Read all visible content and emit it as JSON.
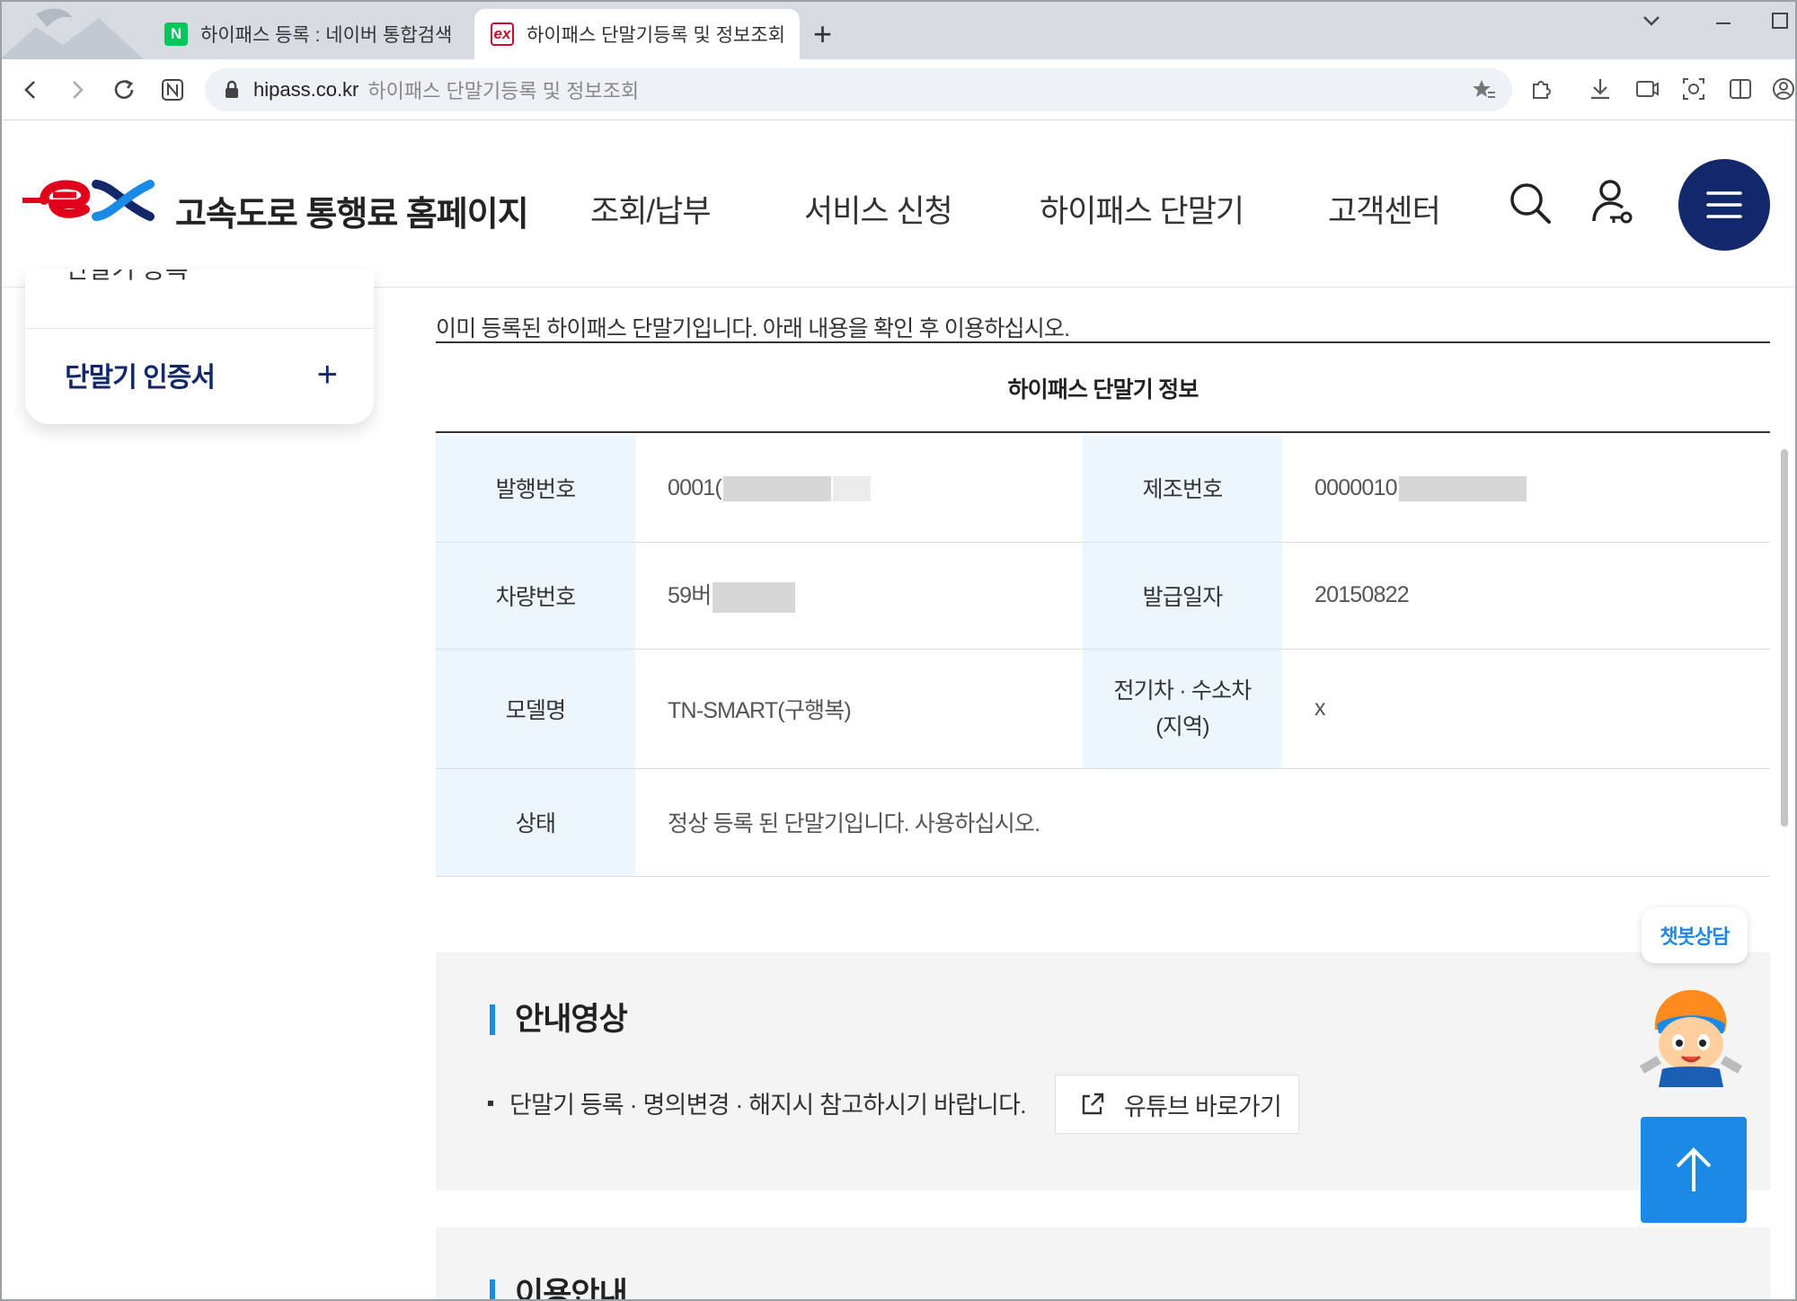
{
  "browser": {
    "tabs": [
      {
        "label": "하이패스 등록 : 네이버 통합검색",
        "favicon": "naver-icon",
        "active": false
      },
      {
        "label": "하이패스 단말기등록 및 정보조회",
        "favicon": "ex-icon",
        "active": true
      }
    ],
    "new_tab": "+",
    "address": {
      "domain": "hipass.co.kr",
      "title": "하이패스 단말기등록 및 정보조회"
    }
  },
  "header": {
    "logo_text": "ex",
    "site_title": "고속도로 통행료 홈페이지",
    "nav": [
      "조회/납부",
      "서비스 신청",
      "하이패스 단말기",
      "고객센터"
    ]
  },
  "side_menu": {
    "partial_item": "단말기 등록",
    "item": "단말기 인증서",
    "expand": "+"
  },
  "notice": "이미 등록된 하이패스 단말기입니다. 아래 내용을 확인 후 이용하십시오.",
  "table": {
    "caption": "하이패스 단말기 정보",
    "rows": [
      {
        "label1": "발행번호",
        "value1": "0001(",
        "label2": "제조번호",
        "value2": "0000010"
      },
      {
        "label1": "차량번호",
        "value1": "59버",
        "label2": "발급일자",
        "value2": "20150822"
      },
      {
        "label1": "모델명",
        "value1": "TN-SMART(구행복)",
        "label2": "전기차 · 수소차(지역)",
        "value2": "x"
      },
      {
        "label1": "상태",
        "value1": "정상 등록 된 단말기입니다. 사용하십시오."
      }
    ]
  },
  "guide": {
    "title": "안내영상",
    "text": "단말기 등록 · 명의변경 · 해지시 참고하시기 바랍니다.",
    "button": "유튜브 바로가기"
  },
  "guide2": {
    "title": "이용안내"
  },
  "chatbot": {
    "label": "챗봇상담"
  },
  "colors": {
    "brand_navy": "#12286b",
    "brand_red": "#e0001b",
    "accent_blue": "#1a8ae6",
    "table_header_bg": "#eef6fd"
  }
}
